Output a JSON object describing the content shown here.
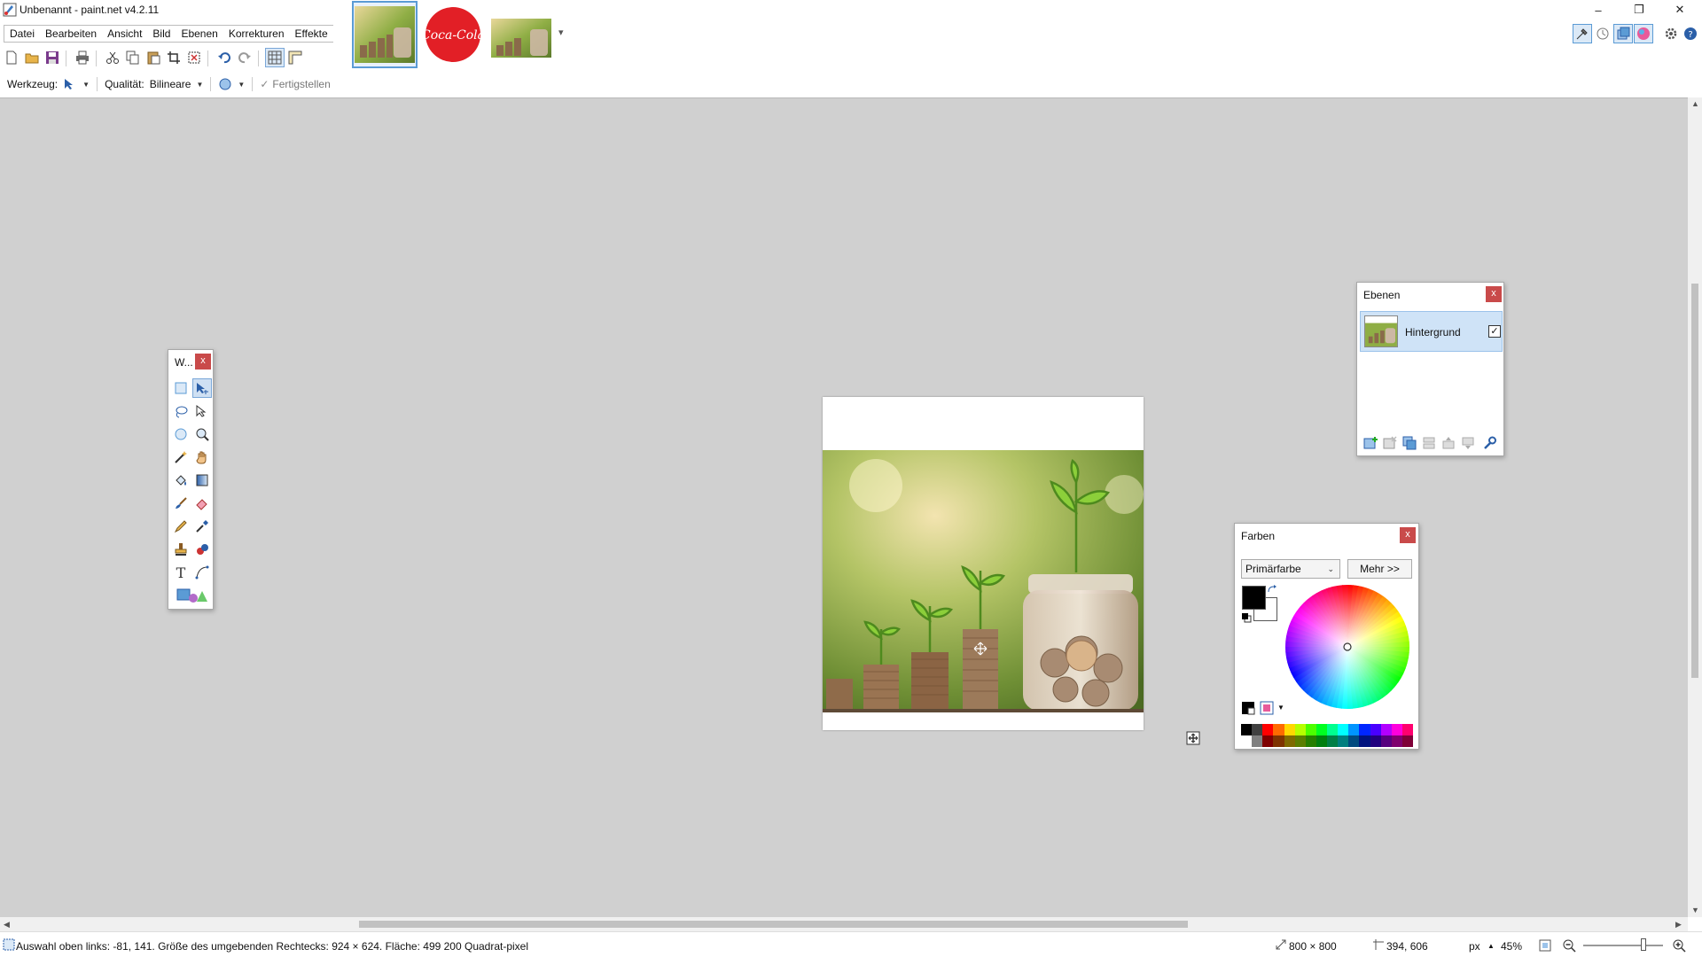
{
  "window": {
    "title": "Unbenannt - paint.net v4.2.11",
    "minimize": "–",
    "restore": "❐",
    "close": "✕"
  },
  "menu": [
    "Datei",
    "Bearbeiten",
    "Ansicht",
    "Bild",
    "Ebenen",
    "Korrekturen",
    "Effekte"
  ],
  "image_tabs": [
    {
      "name": "plants-coins-thumbnail",
      "active": true
    },
    {
      "name": "coca-cola-logo-thumbnail",
      "active": false,
      "logo_text": "Coca-Cola"
    },
    {
      "name": "plants-coins-thumbnail-2",
      "active": false
    }
  ],
  "tab_dropdown": "▾",
  "options": {
    "tool_label": "Werkzeug:",
    "quality_label": "Qualität:",
    "quality_value": "Bilineare",
    "finish_label": "Fertigstellen"
  },
  "tools_window": {
    "title": "W...",
    "close": "x"
  },
  "layers_window": {
    "title": "Ebenen",
    "close": "x",
    "layers": [
      {
        "name": "Hintergrund",
        "visible": true
      }
    ],
    "check": "✓"
  },
  "colors_window": {
    "title": "Farben",
    "close": "x",
    "select_value": "Primärfarbe",
    "more_button": "Mehr >>",
    "primary_color": "#000000",
    "secondary_color": "#ffffff",
    "palette_top": [
      "#000000",
      "#404040",
      "#ff0000",
      "#ff6a00",
      "#ffd800",
      "#b6ff00",
      "#4cff00",
      "#00ff21",
      "#00ff90",
      "#00ffff",
      "#0094ff",
      "#0026ff",
      "#4800ff",
      "#b200ff",
      "#ff00dc",
      "#ff006e"
    ],
    "palette_bottom": [
      "#ffffff",
      "#808080",
      "#7f0000",
      "#7f3300",
      "#7f6a00",
      "#5b7f00",
      "#267f00",
      "#007f0e",
      "#007f46",
      "#007f7f",
      "#004a7f",
      "#00137f",
      "#21007f",
      "#57007f",
      "#7f006e",
      "#7f0037"
    ]
  },
  "status": {
    "selection_text": "Auswahl oben links: -81, 141. Größe des umgebenden Rechtecks: 924 × 624. Fläche: 499 200 Quadrat-pixel",
    "image_size": "800 × 800",
    "cursor_pos": "394, 606",
    "unit": "px",
    "zoom": "45%",
    "zoom_fraction": 0.45
  },
  "icons": {
    "new": "new-file-icon",
    "open": "open-file-icon",
    "save": "save-icon",
    "print": "print-icon",
    "cut": "cut-icon",
    "copy": "copy-icon",
    "paste": "paste-icon",
    "crop": "crop-icon",
    "deselect": "deselect-icon",
    "undo": "undo-icon",
    "redo": "redo-icon",
    "grid": "grid-icon",
    "ruler": "ruler-icon"
  },
  "colors": {
    "canvas_bg": "#d0d0d0",
    "accent": "#5b9bd5",
    "close_red": "#c94a4a"
  }
}
